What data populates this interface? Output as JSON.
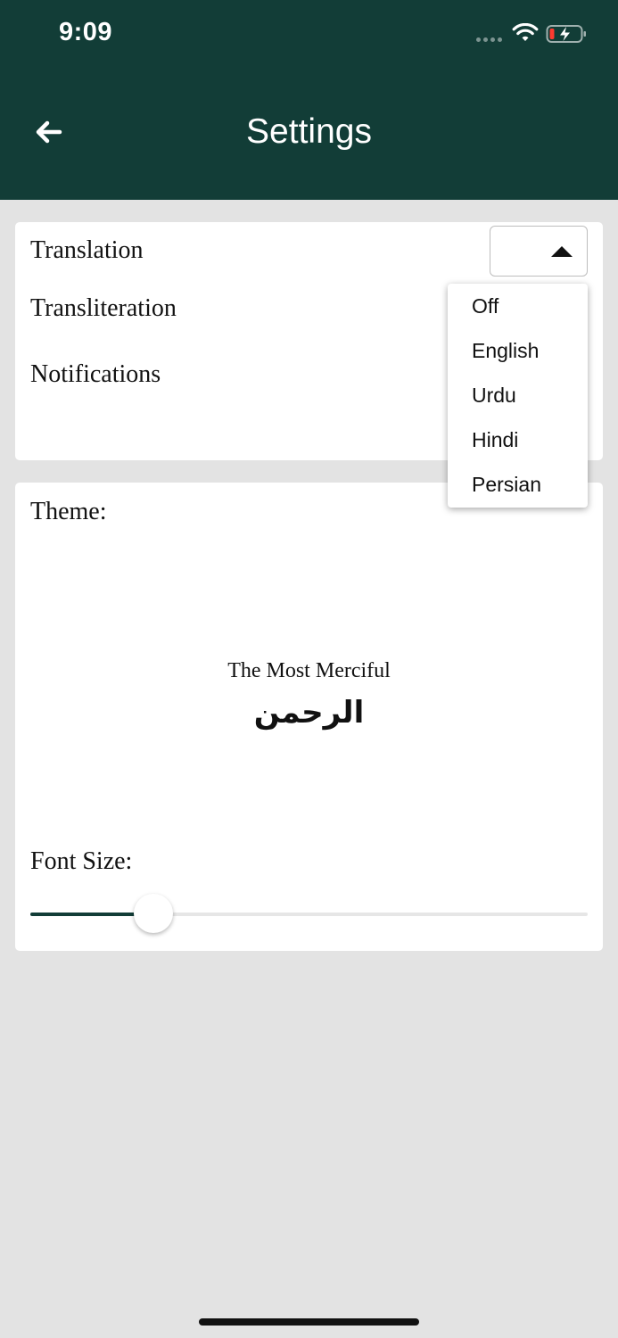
{
  "status_bar": {
    "time": "9:09",
    "icons": [
      "cellular-dots-icon",
      "wifi-icon",
      "battery-charging-icon"
    ]
  },
  "header": {
    "title": "Settings",
    "back_icon": "arrow-left-icon"
  },
  "settings": {
    "translation_label": "Translation",
    "transliteration_label": "Transliteration",
    "notifications_label": "Notifications",
    "translation_value": ""
  },
  "translation_dropdown": {
    "options": [
      "Off",
      "English",
      "Urdu",
      "Hindi",
      "Persian"
    ]
  },
  "theme": {
    "label": "Theme:",
    "preview_english": "The Most Merciful",
    "preview_arabic": "الرحمن"
  },
  "font_size": {
    "label": "Font Size:",
    "value_fraction": 0.22
  },
  "colors": {
    "header_bg": "#123d37",
    "page_bg": "#e3e3e3",
    "accent": "#123d37",
    "card_bg": "#ffffff"
  }
}
